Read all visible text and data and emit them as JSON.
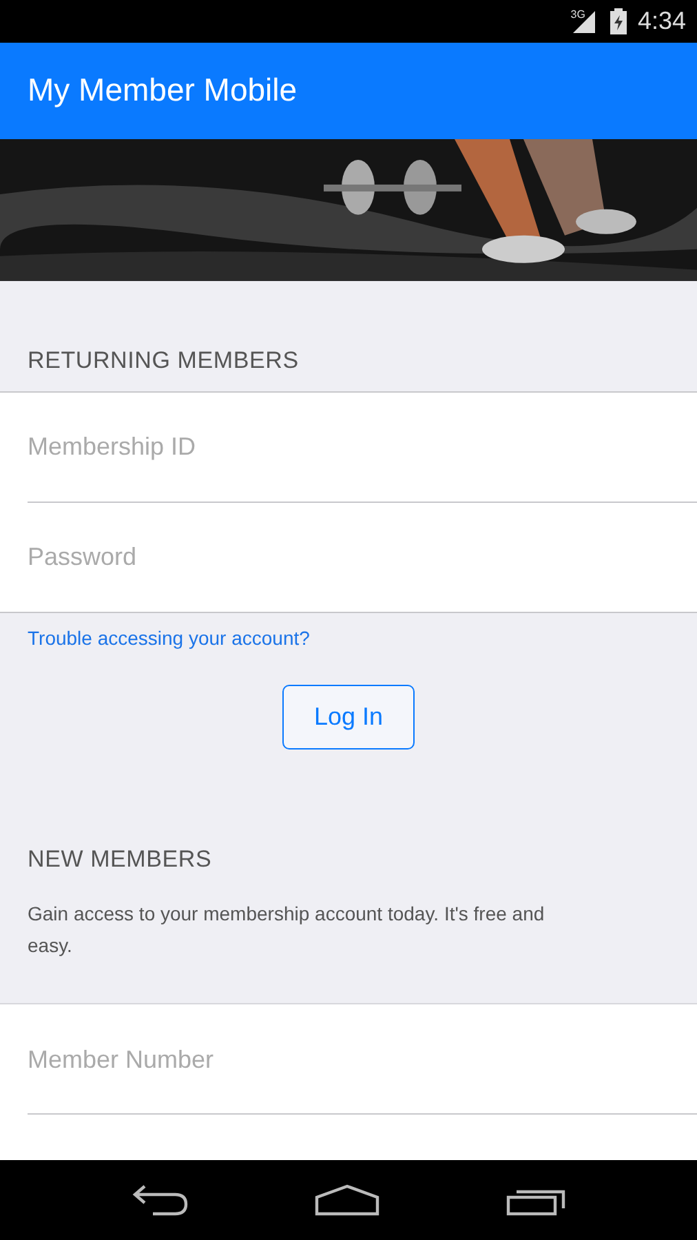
{
  "status_bar": {
    "network": "3G",
    "time": "4:34"
  },
  "app_bar": {
    "title": "My Member Mobile"
  },
  "returning": {
    "heading": "RETURNING MEMBERS",
    "fields": [
      {
        "placeholder": "Membership ID"
      },
      {
        "placeholder": "Password"
      }
    ],
    "link": "Trouble accessing your account?",
    "button": "Log In"
  },
  "new_members": {
    "heading": "NEW MEMBERS",
    "text": "Gain access to your membership account today. It's free and easy.",
    "fields": [
      {
        "placeholder": "Member Number"
      }
    ]
  }
}
